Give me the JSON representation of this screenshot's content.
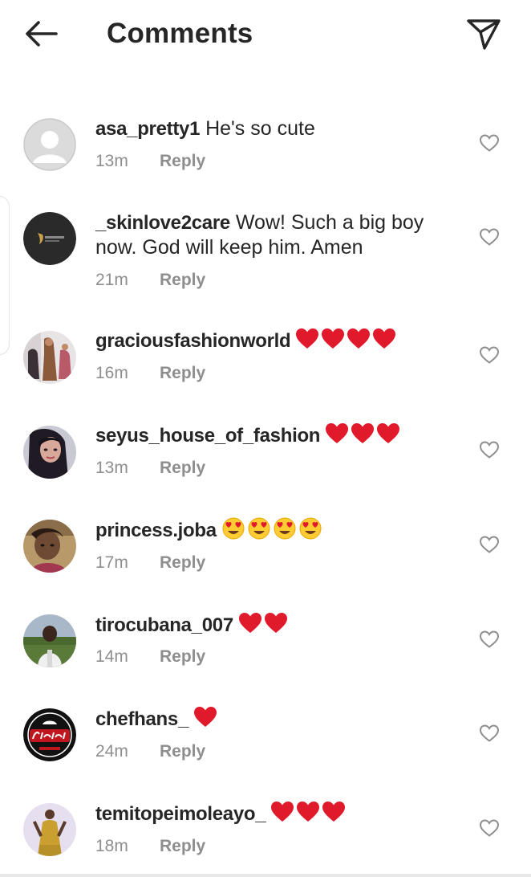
{
  "header": {
    "title": "Comments",
    "back_icon": "arrow-left-icon",
    "share_icon": "paper-plane-icon"
  },
  "colors": {
    "text": "#262626",
    "meta": "#8e8e8e",
    "heart_red": "#e0192b",
    "emoji_yellow": "#ffcc33"
  },
  "reply_label": "Reply",
  "comments": [
    {
      "username": "asa_pretty1",
      "text": "He's so cute",
      "time": "13m",
      "emoji": "",
      "emoji_count": 0,
      "avatar": "default-avatar"
    },
    {
      "username": "_skinlove2care",
      "text": "Wow! Such a big boy now. God will keep him. Amen",
      "time": "21m",
      "emoji": "",
      "emoji_count": 0,
      "avatar": "logo-avatar"
    },
    {
      "username": "graciousfashionworld",
      "text": "",
      "time": "16m",
      "emoji": "red-heart",
      "emoji_count": 4,
      "avatar": "photo-avatar"
    },
    {
      "username": "seyus_house_of_fashion",
      "text": "",
      "time": "13m",
      "emoji": "red-heart",
      "emoji_count": 3,
      "avatar": "photo-avatar"
    },
    {
      "username": "princess.joba",
      "text": "",
      "time": "17m",
      "emoji": "heart-eyes-face",
      "emoji_count": 4,
      "avatar": "photo-avatar"
    },
    {
      "username": "tirocubana_007",
      "text": "",
      "time": "14m",
      "emoji": "red-heart",
      "emoji_count": 2,
      "avatar": "photo-avatar"
    },
    {
      "username": "chefhans_",
      "text": "",
      "time": "24m",
      "emoji": "red-heart",
      "emoji_count": 1,
      "avatar": "logo-avatar"
    },
    {
      "username": "temitopeimoleayo_",
      "text": "",
      "time": "18m",
      "emoji": "red-heart",
      "emoji_count": 3,
      "avatar": "photo-avatar"
    }
  ]
}
